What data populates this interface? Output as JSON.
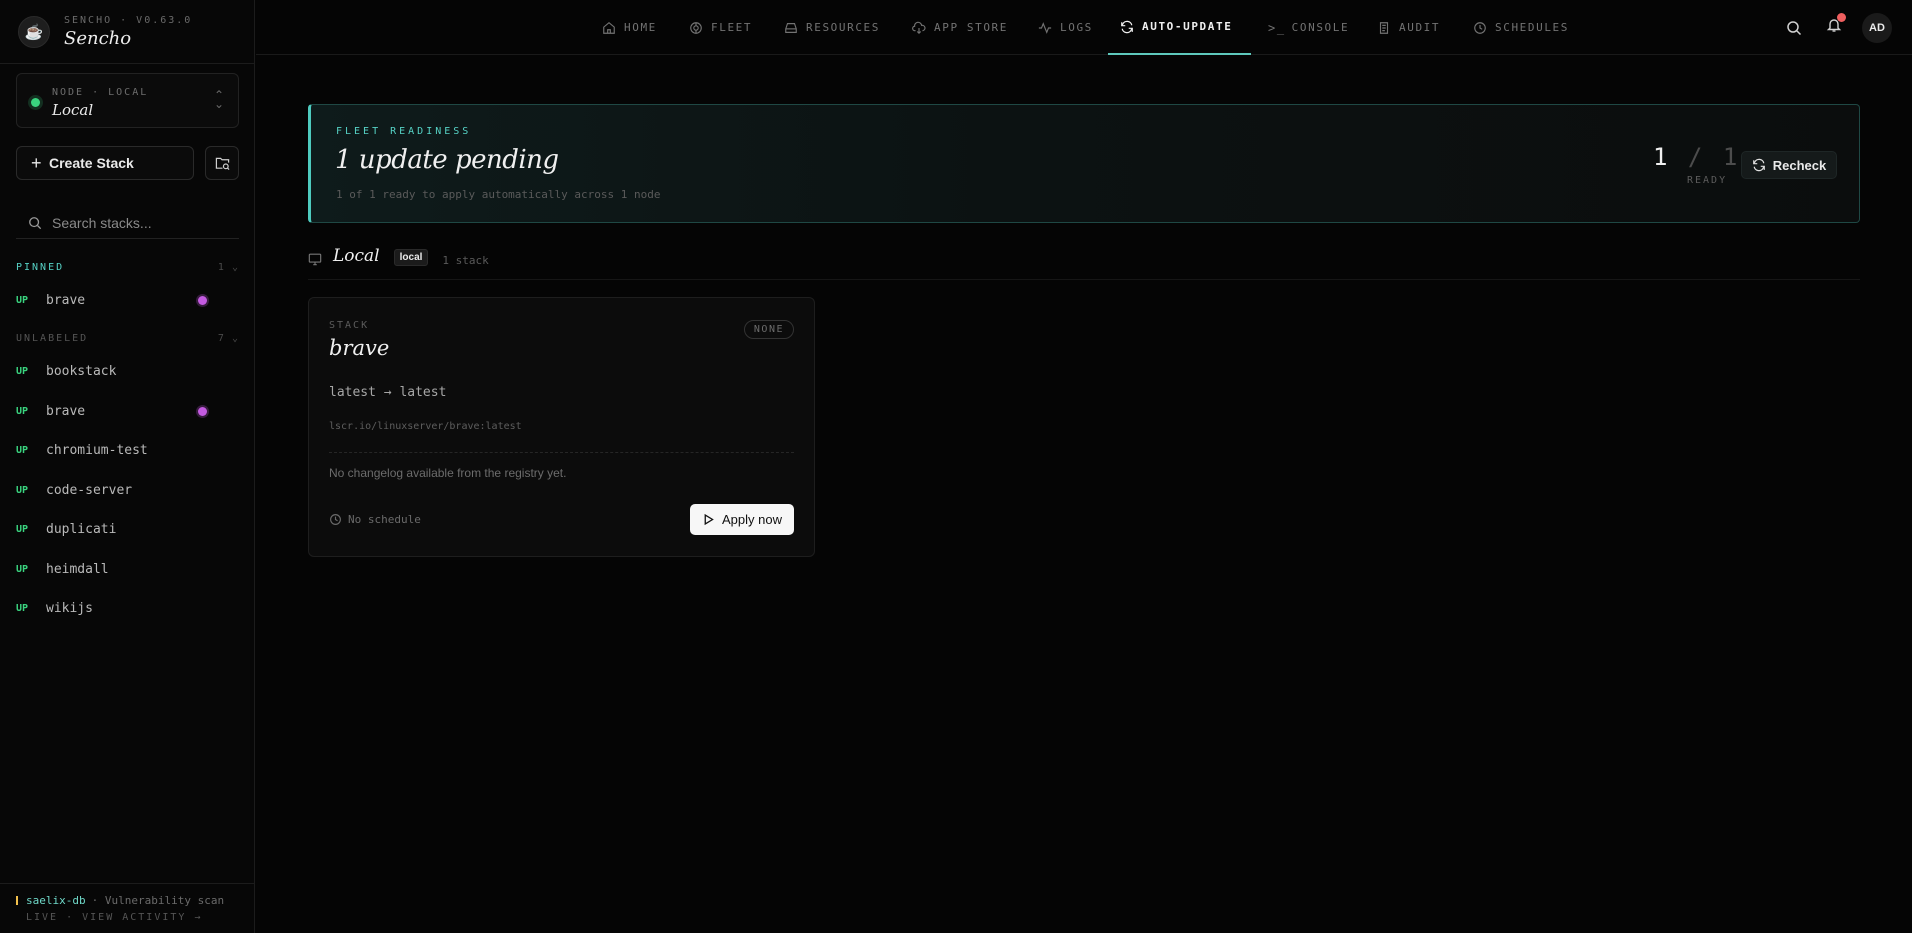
{
  "brand": {
    "version": "SENCHO · V0.63.0",
    "name": "Sencho"
  },
  "node_selector": {
    "label": "NODE · LOCAL",
    "name": "Local"
  },
  "sidebar": {
    "create_label": "Create Stack",
    "search_placeholder": "Search stacks...",
    "groups": [
      {
        "title": "PINNED",
        "count": "1",
        "items": [
          {
            "status": "UP",
            "name": "brave",
            "dot": true
          }
        ]
      },
      {
        "title": "UNLABELED",
        "count": "7",
        "items": [
          {
            "status": "UP",
            "name": "bookstack",
            "dot": false
          },
          {
            "status": "UP",
            "name": "brave",
            "dot": true
          },
          {
            "status": "UP",
            "name": "chromium-test",
            "dot": false
          },
          {
            "status": "UP",
            "name": "code-server",
            "dot": false
          },
          {
            "status": "UP",
            "name": "duplicati",
            "dot": false
          },
          {
            "status": "UP",
            "name": "heimdall",
            "dot": false
          },
          {
            "status": "UP",
            "name": "wikijs",
            "dot": false
          }
        ]
      }
    ],
    "footer": {
      "job": "saelix-db",
      "desc": "· Vulnerability scan",
      "status": "LIVE · VIEW ACTIVITY →"
    }
  },
  "nav": {
    "tabs": [
      {
        "label": "HOME",
        "icon": "home-icon"
      },
      {
        "label": "FLEET",
        "icon": "fleet-icon"
      },
      {
        "label": "RESOURCES",
        "icon": "resources-icon"
      },
      {
        "label": "APP STORE",
        "icon": "app-store-icon"
      },
      {
        "label": "LOGS",
        "icon": "logs-icon"
      },
      {
        "label": "AUTO-UPDATE",
        "icon": "refresh-icon"
      },
      {
        "label": "CONSOLE",
        "icon": "console-icon"
      },
      {
        "label": "AUDIT",
        "icon": "audit-icon"
      },
      {
        "label": "SCHEDULES",
        "icon": "clock-icon"
      }
    ],
    "active": "AUTO-UPDATE",
    "avatar": "AD"
  },
  "readiness": {
    "label": "FLEET READINESS",
    "title": "1 update pending",
    "subtitle": "1 of 1 ready to apply automatically across 1 node",
    "ready": "1",
    "slash": "/",
    "total": "1",
    "ready_word": "READY",
    "recheck_label": "Recheck"
  },
  "node_group": {
    "name": "Local",
    "badge": "local",
    "count": "1 stack"
  },
  "stack_card": {
    "label": "STACK",
    "name": "brave",
    "policy": "NONE",
    "version": "latest → latest",
    "image": "lscr.io/linuxserver/brave:latest",
    "changelog": "No changelog available from the registry yet.",
    "schedule": "No schedule",
    "apply_label": "Apply now"
  },
  "colors": {
    "accent": "#4ecbbf",
    "status_up": "#3ad47f",
    "pin_dot": "#c35ae0",
    "alert": "#ef5f5f"
  }
}
